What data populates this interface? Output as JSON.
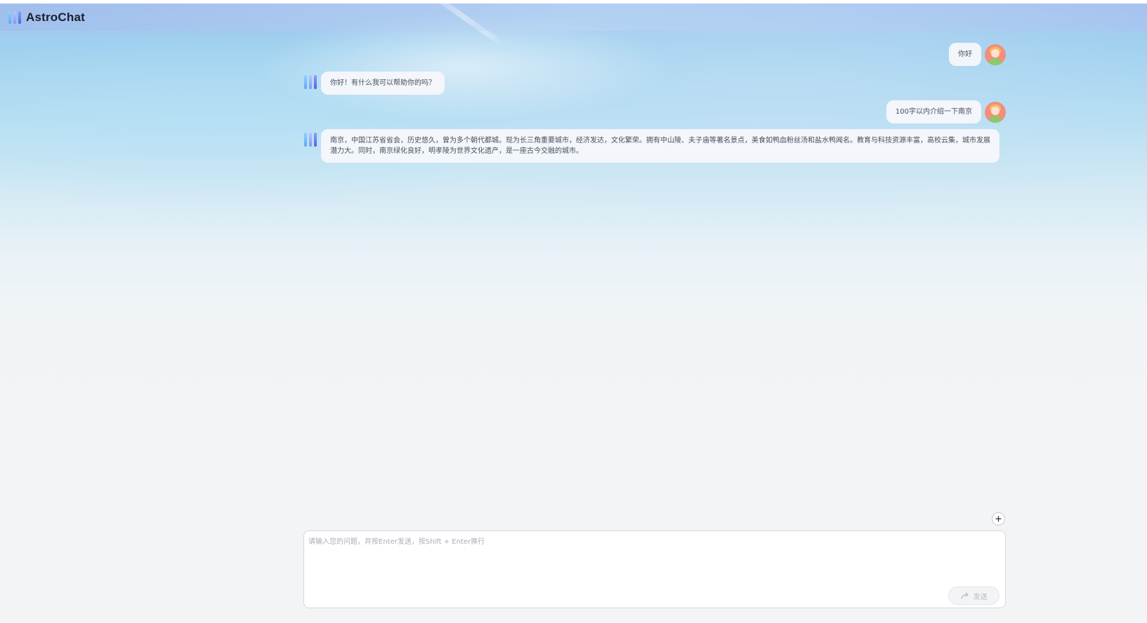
{
  "app": {
    "title": "AstroChat",
    "brand_colors": [
      "#5fa6f6",
      "#7f96f8",
      "#4f63e8"
    ]
  },
  "conversation": {
    "messages": [
      {
        "role": "user",
        "text": "你好"
      },
      {
        "role": "assistant",
        "text": "你好！有什么我可以帮助你的吗？"
      },
      {
        "role": "user",
        "text": "100字以内介绍一下南京"
      },
      {
        "role": "assistant",
        "text": "南京，中国江苏省省会，历史悠久，曾为多个朝代都城。现为长三角重要城市，经济发达，文化繁荣。拥有中山陵、夫子庙等著名景点，美食如鸭血粉丝汤和盐水鸭闻名。教育与科技资源丰富，高校云集，城市发展潜力大。同时，南京绿化良好，明孝陵为世界文化遗产，是一座古今交融的城市。"
      }
    ]
  },
  "composer": {
    "placeholder": "请输入您的问题，并按Enter发送，按Shift + Enter换行",
    "value": "",
    "send_label": "发送",
    "send_icon": "share-arrow-icon",
    "add_icon": "plus-icon"
  }
}
